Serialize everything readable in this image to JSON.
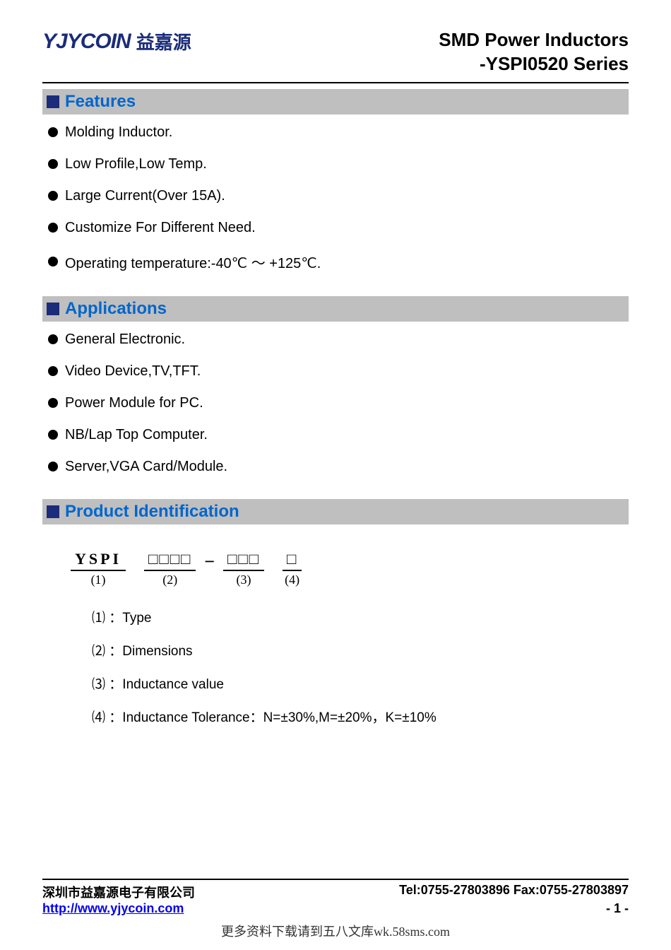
{
  "logo": {
    "main": "YJYCOIN",
    "cn": "益嘉源"
  },
  "doc_title": {
    "line1": "SMD Power Inductors",
    "line2": "-YSPI0520 Series"
  },
  "sections": {
    "features": {
      "title": "Features",
      "items": [
        "Molding Inductor.",
        "Low Profile,Low Temp.",
        "Large Current(Over 15A).",
        "Customize For Different Need.",
        "Operating temperature:-40℃ ～ +125℃."
      ]
    },
    "applications": {
      "title": "Applications",
      "items": [
        "General Electronic.",
        "Video Device,TV,TFT.",
        "Power Module for PC.",
        "NB/Lap Top Computer.",
        "Server,VGA Card/Module."
      ]
    },
    "identification": {
      "title": "Product Identification",
      "scheme": {
        "g1": {
          "top": "YSPI",
          "label": "(1)"
        },
        "g2": {
          "top": "□□□□",
          "label": "(2)"
        },
        "dash": "−",
        "g3": {
          "top": "□□□",
          "label": "(3)"
        },
        "g4": {
          "top": "□",
          "label": "(4)"
        }
      },
      "legend": [
        {
          "num": "⑴",
          "text": "：Type"
        },
        {
          "num": "⑵",
          "text": "：Dimensions"
        },
        {
          "num": "⑶",
          "text": "：Inductance value"
        },
        {
          "num": "⑷",
          "text": "：Inductance Tolerance：N=±30%,M=±20%，K=±10%"
        }
      ]
    }
  },
  "footer": {
    "company": "深圳市益嘉源电子有限公司",
    "contact": "Tel:0755-27803896   Fax:0755-27803897",
    "url": "http://www.yjycoin.com",
    "page": "- 1 -"
  },
  "watermark": "更多资料下载请到五八文库wk.58sms.com"
}
